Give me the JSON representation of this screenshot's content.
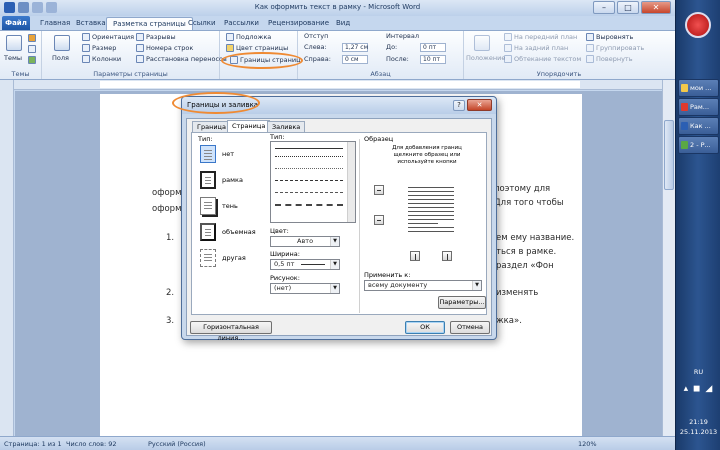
{
  "window": {
    "title": "Как оформить текст в рамку - Microsoft Word",
    "controls": [
      "–",
      "□",
      "✕"
    ]
  },
  "ribbon_tabs": {
    "file": "Файл",
    "items": [
      "Главная",
      "Вставка",
      "Разметка страницы",
      "Ссылки",
      "Рассылки",
      "Рецензирование",
      "Вид"
    ]
  },
  "ribbon": {
    "themes": {
      "label": "Темы",
      "group": "Темы"
    },
    "page_setup": {
      "fields": "Поля",
      "orientation": "Ориентация",
      "size": "Размер",
      "columns": "Колонки",
      "breaks": "Разрывы",
      "line_numbers": "Номера строк",
      "hyphenation": "Расстановка переносов",
      "group": "Параметры страницы"
    },
    "page_background": {
      "watermark": "Подложка",
      "page_color": "Цвет страницы",
      "page_borders": "Границы страниц"
    },
    "indent": {
      "header": "Отступ",
      "left_label": "Слева:",
      "left_value": "1,27 см",
      "right_label": "Справа:",
      "right_value": "0 см"
    },
    "spacing": {
      "header": "Интервал",
      "before_label": "До:",
      "before_value": "0 пт",
      "after_label": "После:",
      "after_value": "10 пт"
    },
    "paragraph_group": "Абзац",
    "arrange": {
      "position": "Положение",
      "bring_forward": "На передний план",
      "send_backward": "На задний план",
      "wrap_text": "Обтекание текстом",
      "align": "Выровнять",
      "group_btn": "Группировать",
      "rotate": "Повернуть",
      "group": "Упорядочить"
    }
  },
  "document": {
    "lines": [
      "оформ",
      "оформ",
      "1.",
      "2.",
      "3.",
      "поэтому для",
      "Для того чтобы",
      "ем ему название.",
      "ться в рамке.",
      "раздел «Фон",
      "изменять",
      "жка»."
    ]
  },
  "status_bar": {
    "page": "Страница: 1 из 1",
    "words": "Число слов: 92",
    "language": "Русский (Россия)",
    "zoom": "120%"
  },
  "taskbar": {
    "items": [
      "мои ...",
      "Рам...",
      "Как ...",
      "2 - Р..."
    ],
    "lang": "RU",
    "time": "21:19",
    "date": "25.11.2013"
  },
  "dialog": {
    "title": "Границы и заливка",
    "help": "?",
    "close": "✕",
    "tabs": [
      "Граница",
      "Страница",
      "Заливка"
    ],
    "type_label": "Тип:",
    "settings": [
      "нет",
      "рамка",
      "тень",
      "объемная",
      "другая"
    ],
    "style_label": "Тип:",
    "color_label": "Цвет:",
    "color_value": "Авто",
    "width_label": "Ширина:",
    "width_value": "0,5 пт",
    "art_label": "Рисунок:",
    "art_value": "(нет)",
    "preview_label": "Образец",
    "preview_hint": "Для добавления границ щелкните образец или используйте кнопки",
    "apply_label": "Применить к:",
    "apply_value": "всему документу",
    "options_btn": "Параметры...",
    "horizontal_line_btn": "Горизонтальная линия...",
    "ok_btn": "ОК",
    "cancel_btn": "Отмена"
  },
  "colors": {
    "highlight": "#ef8a33",
    "ribbon_bg": "#dce7f5",
    "doc_bg": "#9fb3d0",
    "taskbar": "#2c5590"
  }
}
